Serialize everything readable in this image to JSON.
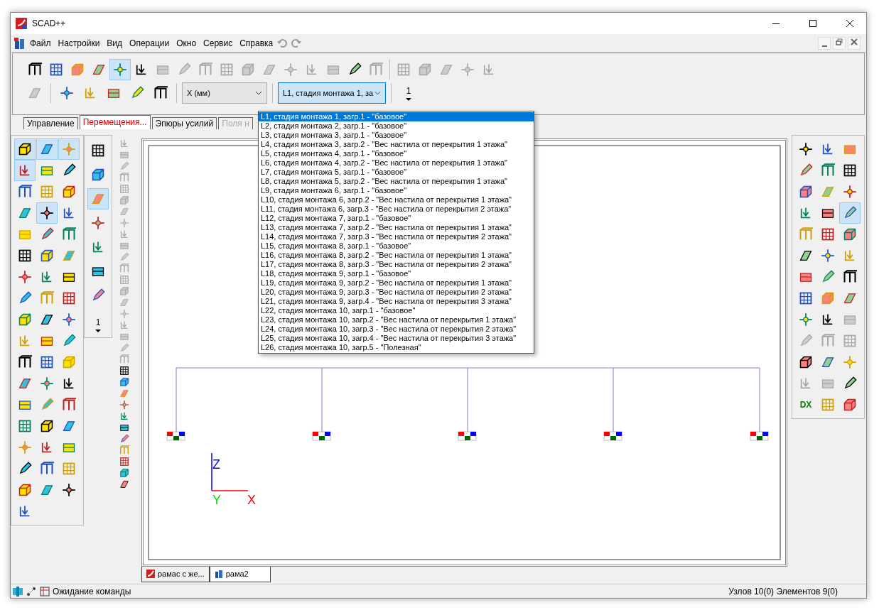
{
  "window": {
    "title": "SCAD++"
  },
  "menu": [
    "Файл",
    "Настройки",
    "Вид",
    "Операции",
    "Окно",
    "Сервис",
    "Справка"
  ],
  "toolbar_row1": [
    {
      "selected": false,
      "disabled": false
    },
    {
      "selected": false,
      "disabled": false
    },
    {
      "selected": false,
      "disabled": false
    },
    {
      "selected": false,
      "disabled": false
    },
    {
      "selected": true,
      "disabled": false
    },
    {
      "selected": false,
      "disabled": false
    },
    {
      "selected": false,
      "disabled": true
    },
    {
      "selected": false,
      "disabled": true
    },
    {
      "selected": false,
      "disabled": true
    },
    {
      "selected": false,
      "disabled": true
    },
    {
      "selected": false,
      "disabled": true
    },
    {
      "selected": false,
      "disabled": true
    },
    {
      "selected": false,
      "disabled": true
    },
    {
      "selected": false,
      "disabled": true
    },
    {
      "selected": false,
      "disabled": true
    },
    {
      "selected": false,
      "disabled": false
    },
    {
      "selected": false,
      "disabled": true
    },
    {
      "selected": false,
      "disabled": true
    },
    {
      "selected": false,
      "disabled": true
    },
    {
      "selected": false,
      "disabled": true
    },
    {
      "selected": false,
      "disabled": true
    },
    {
      "selected": false,
      "disabled": true
    }
  ],
  "toolbar_row2": [
    {
      "selected": false,
      "disabled": true
    },
    {
      "selected": false,
      "disabled": false
    },
    {
      "selected": false,
      "disabled": false
    },
    {
      "selected": false,
      "disabled": false
    },
    {
      "selected": false,
      "disabled": false
    },
    {
      "selected": false,
      "disabled": false
    }
  ],
  "unit_select": {
    "value": "X (мм)"
  },
  "load_select": {
    "value": "L1, стадия монтажа 1, за"
  },
  "mode_select": {
    "value": "1"
  },
  "tabs": [
    {
      "label": "Управление",
      "selected": false,
      "disabled": false
    },
    {
      "label": "Перемещения...",
      "selected": true,
      "disabled": false
    },
    {
      "label": "Эпюры усилий",
      "selected": false,
      "disabled": false
    },
    {
      "label": "Поля н",
      "selected": false,
      "disabled": true
    }
  ],
  "load_list": [
    {
      "label": "L1, стадия монтажа 1, загр.1 - \"базовое\"",
      "selected": true
    },
    {
      "label": "L2, стадия монтажа 2, загр.1 - \"базовое\"",
      "selected": false
    },
    {
      "label": "L3, стадия монтажа 3, загр.1 - \"базовое\"",
      "selected": false
    },
    {
      "label": "L4, стадия монтажа 3, загр.2 - \"Вес настила от перекрытия 1 этажа\"",
      "selected": false
    },
    {
      "label": "L5, стадия монтажа 4, загр.1 - \"базовое\"",
      "selected": false
    },
    {
      "label": "L6, стадия монтажа 4, загр.2 - \"Вес настила от перекрытия 1 этажа\"",
      "selected": false
    },
    {
      "label": "L7, стадия монтажа 5, загр.1 - \"базовое\"",
      "selected": false
    },
    {
      "label": "L8, стадия монтажа 5, загр.2 - \"Вес настила от перекрытия 1 этажа\"",
      "selected": false
    },
    {
      "label": "L9, стадия монтажа 6, загр.1 - \"базовое\"",
      "selected": false
    },
    {
      "label": "L10, стадия монтажа 6, загр.2 - \"Вес настила от перекрытия 1 этажа\"",
      "selected": false
    },
    {
      "label": "L11, стадия монтажа 6, загр.3 - \"Вес настила от перекрытия 2 этажа\"",
      "selected": false
    },
    {
      "label": "L12, стадия монтажа 7, загр.1 - \"базовое\"",
      "selected": false
    },
    {
      "label": "L13, стадия монтажа 7, загр.2 - \"Вес настила от перекрытия 1 этажа\"",
      "selected": false
    },
    {
      "label": "L14, стадия монтажа 7, загр.3 - \"Вес настила от перекрытия 2 этажа\"",
      "selected": false
    },
    {
      "label": "L15, стадия монтажа 8, загр.1 - \"базовое\"",
      "selected": false
    },
    {
      "label": "L16, стадия монтажа 8, загр.2 - \"Вес настила от перекрытия 1 этажа\"",
      "selected": false
    },
    {
      "label": "L17, стадия монтажа 8, загр.3 - \"Вес настила от перекрытия 2 этажа\"",
      "selected": false
    },
    {
      "label": "L18, стадия монтажа 9, загр.1 - \"базовое\"",
      "selected": false
    },
    {
      "label": "L19, стадия монтажа 9, загр.2 - \"Вес настила от перекрытия 1 этажа\"",
      "selected": false
    },
    {
      "label": "L20, стадия монтажа 9, загр.3 - \"Вес настила от перекрытия 2 этажа\"",
      "selected": false
    },
    {
      "label": "L21, стадия монтажа 9, загр.4 - \"Вес настила от перекрытия 3 этажа\"",
      "selected": false
    },
    {
      "label": "L22, стадия монтажа 10, загр.1 - \"базовое\"",
      "selected": false
    },
    {
      "label": "L23, стадия монтажа 10, загр.2 - \"Вес настила от перекрытия 1 этажа\"",
      "selected": false
    },
    {
      "label": "L24, стадия монтажа 10, загр.3 - \"Вес настила от перекрытия 2 этажа\"",
      "selected": false
    },
    {
      "label": "L25, стадия монтажа 10, загр.4 - \"Вес настила от перекрытия 3 этажа\"",
      "selected": false
    },
    {
      "label": "L26, стадия монтажа 10, загр.5 - \"Полезная\"",
      "selected": false
    }
  ],
  "left_palette": [
    {
      "selected": true
    },
    {
      "selected": true
    },
    {
      "selected": true
    },
    {
      "selected": true
    },
    {
      "selected": false
    },
    {
      "selected": false
    },
    {
      "selected": false
    },
    {
      "selected": false
    },
    {
      "selected": false
    },
    {
      "selected": false
    },
    {
      "selected": true
    },
    {
      "selected": false
    },
    {
      "selected": false
    },
    {
      "selected": false
    },
    {
      "selected": false
    },
    {
      "selected": false
    },
    {
      "selected": false
    },
    {
      "selected": false
    },
    {
      "selected": false
    },
    {
      "selected": false
    },
    {
      "selected": false
    },
    {
      "selected": false
    },
    {
      "selected": false
    },
    {
      "selected": false
    },
    {
      "selected": false
    },
    {
      "selected": false
    },
    {
      "selected": false
    },
    {
      "selected": false
    },
    {
      "selected": false
    },
    {
      "selected": false
    },
    {
      "selected": false
    },
    {
      "selected": false
    },
    {
      "selected": false
    },
    {
      "selected": false
    },
    {
      "selected": false
    },
    {
      "selected": false
    },
    {
      "selected": false
    },
    {
      "selected": false
    },
    {
      "selected": false
    },
    {
      "selected": false
    },
    {
      "selected": false
    },
    {
      "selected": false
    },
    {
      "selected": false
    },
    {
      "selected": false
    },
    {
      "selected": false
    },
    {
      "selected": false
    },
    {
      "selected": false
    },
    {
      "selected": false
    },
    {
      "selected": false
    },
    {
      "selected": false
    },
    {
      "selected": false
    },
    {
      "selected": false
    }
  ],
  "mid_palette": [
    {
      "selected": false
    },
    {
      "selected": false
    },
    {
      "selected": true
    },
    {
      "selected": false
    },
    {
      "selected": false
    },
    {
      "selected": false
    },
    {
      "selected": false
    }
  ],
  "mid_select": {
    "value": "1"
  },
  "aux_palette": [
    {
      "disabled": true
    },
    {
      "disabled": true
    },
    {
      "disabled": true
    },
    {
      "disabled": true
    },
    {
      "disabled": true
    },
    {
      "disabled": true
    },
    {
      "disabled": true
    },
    {
      "disabled": true
    },
    {
      "disabled": true
    },
    {
      "disabled": true
    },
    {
      "disabled": true
    },
    {
      "disabled": true
    },
    {
      "disabled": true
    },
    {
      "disabled": true
    },
    {
      "disabled": true
    },
    {
      "disabled": true
    },
    {
      "disabled": true
    },
    {
      "disabled": true
    },
    {
      "disabled": true
    },
    {
      "disabled": true
    },
    {
      "disabled": false
    },
    {
      "disabled": false
    },
    {
      "disabled": false
    },
    {
      "disabled": false
    },
    {
      "disabled": false
    },
    {
      "disabled": false
    },
    {
      "disabled": false
    },
    {
      "disabled": false
    },
    {
      "disabled": false
    },
    {
      "disabled": false
    },
    {
      "disabled": false
    }
  ],
  "right_palette": [
    {
      "selected": false,
      "disabled": false
    },
    {
      "selected": false,
      "disabled": false
    },
    {
      "selected": false,
      "disabled": false
    },
    {
      "selected": false,
      "disabled": false
    },
    {
      "selected": false,
      "disabled": false
    },
    {
      "selected": false,
      "disabled": false
    },
    {
      "selected": false,
      "disabled": false
    },
    {
      "selected": false,
      "disabled": false
    },
    {
      "selected": false,
      "disabled": false
    },
    {
      "selected": false,
      "disabled": false
    },
    {
      "selected": false,
      "disabled": false
    },
    {
      "selected": true,
      "disabled": false
    },
    {
      "selected": false,
      "disabled": false
    },
    {
      "selected": false,
      "disabled": false
    },
    {
      "selected": false,
      "disabled": false
    },
    {
      "selected": false,
      "disabled": false
    },
    {
      "selected": false,
      "disabled": false
    },
    {
      "selected": false,
      "disabled": false
    },
    {
      "selected": false,
      "disabled": false
    },
    {
      "selected": false,
      "disabled": false
    },
    {
      "selected": false,
      "disabled": false
    },
    {
      "selected": false,
      "disabled": false
    },
    {
      "selected": false,
      "disabled": false
    },
    {
      "selected": false,
      "disabled": false
    },
    {
      "selected": false,
      "disabled": false
    },
    {
      "selected": false,
      "disabled": false
    },
    {
      "selected": false,
      "disabled": true
    },
    {
      "selected": false,
      "disabled": true
    },
    {
      "selected": false,
      "disabled": true
    },
    {
      "selected": false,
      "disabled": true
    },
    {
      "selected": false,
      "disabled": false
    },
    {
      "selected": false,
      "disabled": false
    },
    {
      "selected": false,
      "disabled": false
    },
    {
      "selected": false,
      "disabled": true
    },
    {
      "selected": false,
      "disabled": true
    },
    {
      "selected": false,
      "disabled": false
    },
    {
      "selected": false,
      "disabled": false,
      "label": "DX"
    },
    {
      "selected": false,
      "disabled": false
    },
    {
      "selected": false,
      "disabled": false
    }
  ],
  "axes": [
    {
      "label": "Z",
      "color": "#0000ff"
    },
    {
      "label": "Y",
      "color": "#00dd00"
    },
    {
      "label": "X",
      "color": "#ff0000"
    }
  ],
  "document_tabs": [
    {
      "label": "рамас с же...",
      "selected": false
    },
    {
      "label": "рама2",
      "selected": true
    }
  ],
  "status_bar": {
    "message": "Ожидание команды",
    "counts": "Узлов 10(0) Элементов 9(0)"
  }
}
